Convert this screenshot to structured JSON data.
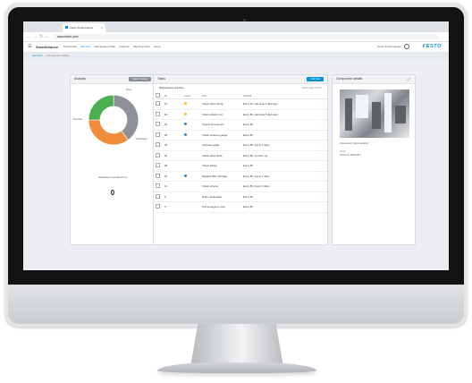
{
  "browser": {
    "tab_title": "Festo Smartenance",
    "url": "www.festo.com"
  },
  "app": {
    "brand": "Smartenance",
    "nav": [
      "Dashboard",
      "Services",
      "Maintenance Plan",
      "Logbook",
      "Planning View",
      "Users"
    ],
    "active_nav": "Services",
    "user": "Festo Smartenance",
    "logo": "FESTO"
  },
  "breadcrumb": [
    "Services",
    "Component details"
  ],
  "analysis": {
    "title": "Analysis",
    "button": "Select Periods",
    "chart_data": {
      "type": "pie",
      "labels": [
        "Done",
        "Overdue",
        "Scheduled"
      ],
      "values": [
        40,
        35,
        25
      ],
      "colors": [
        "#8c9197",
        "#f08c3a",
        "#4caf50"
      ]
    },
    "legend": "Scheduled  Overdue  Done",
    "count": "0"
  },
  "tasks": {
    "title": "Tasks",
    "button": "Add Task",
    "subtitle": "Maintenance activities",
    "filters": "Status  Date  Search",
    "columns": [
      "",
      "ID",
      "Level",
      "Title",
      "Interval"
    ],
    "rows": [
      {
        "id": "14",
        "sev": "#f5c518",
        "title": "Check valve wiring",
        "interval": "Every 4h, last done 2 days ago"
      },
      {
        "id": "16",
        "sev": "#f5c518",
        "title": "Clean cylinder rod",
        "interval": "Every 8h, last done 5 days ago"
      },
      {
        "id": "18",
        "sev": "#2f7fd1",
        "title": "Inspect air prep unit",
        "interval": "Every 8h"
      },
      {
        "id": "20",
        "sev": "#2f7fd1",
        "title": "Check pressure gauge",
        "interval": "Every 8h"
      },
      {
        "id": "24",
        "sev": "",
        "title": "Lubricate guide",
        "interval": "Every 8h, due in 5 days"
      },
      {
        "id": "26",
        "sev": "",
        "title": "Check valve block",
        "interval": "Every 8h, no done yet"
      },
      {
        "id": "28",
        "sev": "",
        "title": "Check tubing",
        "interval": "Every 8h"
      },
      {
        "id": "30",
        "sev": "#2f7fd1",
        "title": "Replace filter cartridge",
        "interval": "Every 8h, due in 2 days"
      },
      {
        "id": "31",
        "sev": "",
        "title": "Check oil level",
        "interval": "Every 8h, due in 3 days"
      },
      {
        "id": "5",
        "sev": "",
        "title": "Drain condensate",
        "interval": "Every 8h"
      },
      {
        "id": "3",
        "sev": "",
        "title": "Test emergency stop",
        "interval": "Every 8h"
      }
    ]
  },
  "component": {
    "title": "Component details",
    "caption": "Component: Valve manifold",
    "line1": "Serial",
    "line2": "VTUG-10-VRLK-B1T"
  }
}
